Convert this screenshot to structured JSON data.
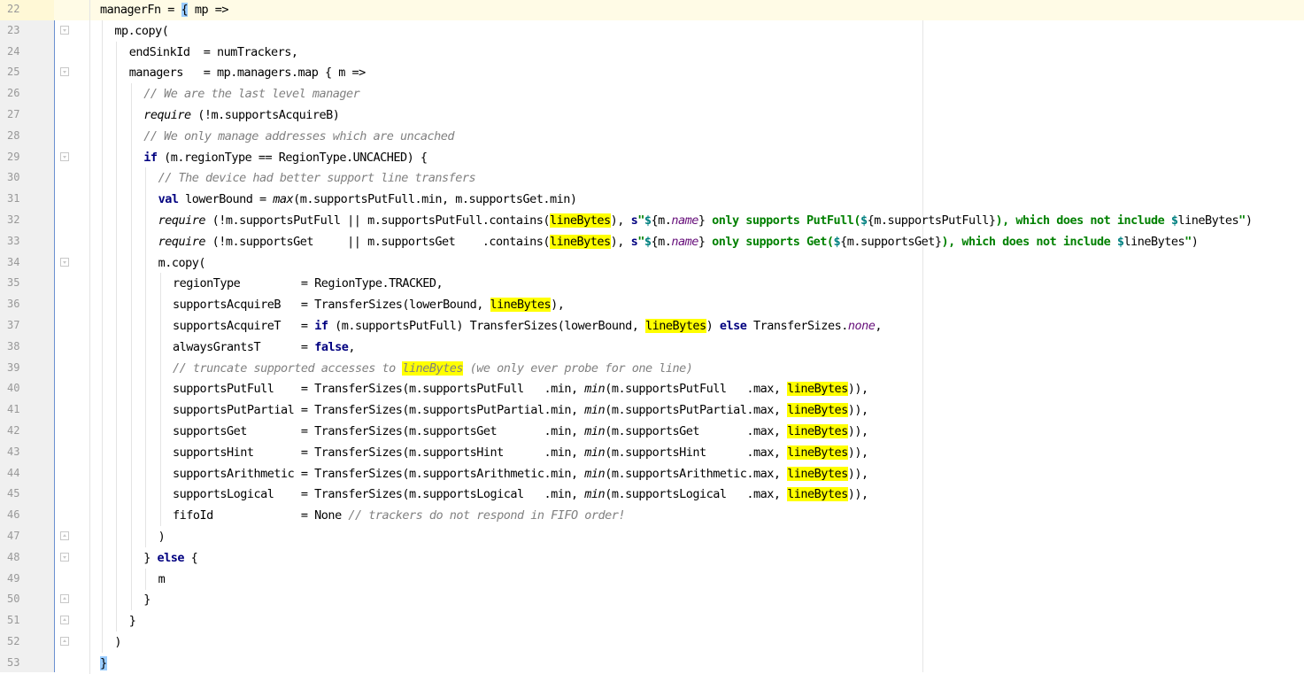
{
  "editor": {
    "lines": [
      {
        "num": "22",
        "indent": 0,
        "current": true,
        "fold": "none",
        "tokens": [
          [
            "plain",
            "managerFn = "
          ],
          [
            "brace",
            "{"
          ],
          [
            "plain",
            " mp =>"
          ]
        ]
      },
      {
        "num": "23",
        "indent": 1,
        "fold": "open",
        "tokens": [
          [
            "plain",
            "mp.copy("
          ]
        ]
      },
      {
        "num": "24",
        "indent": 2,
        "fold": "none",
        "tokens": [
          [
            "plain",
            "endSinkId  = numTrackers,"
          ]
        ]
      },
      {
        "num": "25",
        "indent": 2,
        "fold": "open",
        "tokens": [
          [
            "plain",
            "managers   = mp.managers.map { m =>"
          ]
        ]
      },
      {
        "num": "26",
        "indent": 3,
        "fold": "none",
        "tokens": [
          [
            "cm",
            "// We are the last level manager"
          ]
        ]
      },
      {
        "num": "27",
        "indent": 3,
        "fold": "none",
        "tokens": [
          [
            "ital",
            "require"
          ],
          [
            "plain",
            " (!m.supportsAcquireB)"
          ]
        ]
      },
      {
        "num": "28",
        "indent": 3,
        "fold": "none",
        "tokens": [
          [
            "cm",
            "// We only manage addresses which are uncached"
          ]
        ]
      },
      {
        "num": "29",
        "indent": 3,
        "fold": "open",
        "tokens": [
          [
            "kw",
            "if"
          ],
          [
            "plain",
            " (m.regionType == RegionType.UNCACHED) {"
          ]
        ]
      },
      {
        "num": "30",
        "indent": 4,
        "fold": "none",
        "tokens": [
          [
            "cm",
            "// The device had better support line transfers"
          ]
        ]
      },
      {
        "num": "31",
        "indent": 4,
        "fold": "none",
        "tokens": [
          [
            "kw",
            "val"
          ],
          [
            "plain",
            " lowerBound = "
          ],
          [
            "ital",
            "max"
          ],
          [
            "plain",
            "(m.supportsPutFull.min, m.supportsGet.min)"
          ]
        ]
      },
      {
        "num": "32",
        "indent": 4,
        "fold": "none",
        "tokens": [
          [
            "ital",
            "require"
          ],
          [
            "plain",
            " (!m.supportsPutFull || m.supportsPutFull.contains("
          ],
          [
            "hl",
            "lineBytes"
          ],
          [
            "plain",
            "), "
          ],
          [
            "kw",
            "s"
          ],
          [
            "str",
            "\""
          ],
          [
            "interp",
            "$"
          ],
          [
            "plain",
            "{m."
          ],
          [
            "fld",
            "name"
          ],
          [
            "plain",
            "}"
          ],
          [
            "str",
            " only supports PutFull("
          ],
          [
            "interp",
            "$"
          ],
          [
            "plain",
            "{m.supportsPutFull}"
          ],
          [
            "str",
            "), which does not include "
          ],
          [
            "interp",
            "$"
          ],
          [
            "plain",
            "lineBytes"
          ],
          [
            "str",
            "\""
          ],
          [
            "plain",
            ")"
          ]
        ]
      },
      {
        "num": "33",
        "indent": 4,
        "fold": "none",
        "tokens": [
          [
            "ital",
            "require"
          ],
          [
            "plain",
            " (!m.supportsGet     || m.supportsGet    .contains("
          ],
          [
            "hl",
            "lineBytes"
          ],
          [
            "plain",
            "), "
          ],
          [
            "kw",
            "s"
          ],
          [
            "str",
            "\""
          ],
          [
            "interp",
            "$"
          ],
          [
            "plain",
            "{m."
          ],
          [
            "fld",
            "name"
          ],
          [
            "plain",
            "}"
          ],
          [
            "str",
            " only supports Get("
          ],
          [
            "interp",
            "$"
          ],
          [
            "plain",
            "{m.supportsGet}"
          ],
          [
            "str",
            "), which does not include "
          ],
          [
            "interp",
            "$"
          ],
          [
            "plain",
            "lineBytes"
          ],
          [
            "str",
            "\""
          ],
          [
            "plain",
            ")"
          ]
        ]
      },
      {
        "num": "34",
        "indent": 4,
        "fold": "open",
        "tokens": [
          [
            "plain",
            "m.copy("
          ]
        ]
      },
      {
        "num": "35",
        "indent": 5,
        "fold": "none",
        "tokens": [
          [
            "plain",
            "regionType         = RegionType.TRACKED,"
          ]
        ]
      },
      {
        "num": "36",
        "indent": 5,
        "fold": "none",
        "tokens": [
          [
            "plain",
            "supportsAcquireB   = TransferSizes(lowerBound, "
          ],
          [
            "hl",
            "lineBytes"
          ],
          [
            "plain",
            "),"
          ]
        ]
      },
      {
        "num": "37",
        "indent": 5,
        "fold": "none",
        "tokens": [
          [
            "plain",
            "supportsAcquireT   = "
          ],
          [
            "kw",
            "if"
          ],
          [
            "plain",
            " (m.supportsPutFull) TransferSizes(lowerBound, "
          ],
          [
            "hl",
            "lineBytes"
          ],
          [
            "plain",
            ") "
          ],
          [
            "kw",
            "else"
          ],
          [
            "plain",
            " TransferSizes."
          ],
          [
            "fld",
            "none"
          ],
          [
            "plain",
            ","
          ]
        ]
      },
      {
        "num": "38",
        "indent": 5,
        "fold": "none",
        "tokens": [
          [
            "plain",
            "alwaysGrantsT      = "
          ],
          [
            "kw",
            "false"
          ],
          [
            "plain",
            ","
          ]
        ]
      },
      {
        "num": "39",
        "indent": 5,
        "fold": "none",
        "tokens": [
          [
            "cm",
            "// truncate supported accesses to "
          ],
          [
            "hlcm",
            "lineBytes"
          ],
          [
            "cm",
            " (we only ever probe for one line)"
          ]
        ]
      },
      {
        "num": "40",
        "indent": 5,
        "fold": "none",
        "tokens": [
          [
            "plain",
            "supportsPutFull    = TransferSizes(m.supportsPutFull   .min, "
          ],
          [
            "ital",
            "min"
          ],
          [
            "plain",
            "(m.supportsPutFull   .max, "
          ],
          [
            "hl",
            "lineBytes"
          ],
          [
            "plain",
            ")),"
          ]
        ]
      },
      {
        "num": "41",
        "indent": 5,
        "fold": "none",
        "tokens": [
          [
            "plain",
            "supportsPutPartial = TransferSizes(m.supportsPutPartial.min, "
          ],
          [
            "ital",
            "min"
          ],
          [
            "plain",
            "(m.supportsPutPartial.max, "
          ],
          [
            "hl",
            "lineBytes"
          ],
          [
            "plain",
            ")),"
          ]
        ]
      },
      {
        "num": "42",
        "indent": 5,
        "fold": "none",
        "tokens": [
          [
            "plain",
            "supportsGet        = TransferSizes(m.supportsGet       .min, "
          ],
          [
            "ital",
            "min"
          ],
          [
            "plain",
            "(m.supportsGet       .max, "
          ],
          [
            "hl",
            "lineBytes"
          ],
          [
            "plain",
            ")),"
          ]
        ]
      },
      {
        "num": "43",
        "indent": 5,
        "fold": "none",
        "tokens": [
          [
            "plain",
            "supportsHint       = TransferSizes(m.supportsHint      .min, "
          ],
          [
            "ital",
            "min"
          ],
          [
            "plain",
            "(m.supportsHint      .max, "
          ],
          [
            "hl",
            "lineBytes"
          ],
          [
            "plain",
            ")),"
          ]
        ]
      },
      {
        "num": "44",
        "indent": 5,
        "fold": "none",
        "tokens": [
          [
            "plain",
            "supportsArithmetic = TransferSizes(m.supportsArithmetic.min, "
          ],
          [
            "ital",
            "min"
          ],
          [
            "plain",
            "(m.supportsArithmetic.max, "
          ],
          [
            "hl",
            "lineBytes"
          ],
          [
            "plain",
            ")),"
          ]
        ]
      },
      {
        "num": "45",
        "indent": 5,
        "fold": "none",
        "tokens": [
          [
            "plain",
            "supportsLogical    = TransferSizes(m.supportsLogical   .min, "
          ],
          [
            "ital",
            "min"
          ],
          [
            "plain",
            "(m.supportsLogical   .max, "
          ],
          [
            "hl",
            "lineBytes"
          ],
          [
            "plain",
            ")),"
          ]
        ]
      },
      {
        "num": "46",
        "indent": 5,
        "fold": "none",
        "tokens": [
          [
            "plain",
            "fifoId             = None "
          ],
          [
            "cm",
            "// trackers do not respond in FIFO order!"
          ]
        ]
      },
      {
        "num": "47",
        "indent": 4,
        "fold": "close",
        "tokens": [
          [
            "plain",
            ")"
          ]
        ]
      },
      {
        "num": "48",
        "indent": 3,
        "fold": "open",
        "tokens": [
          [
            "plain",
            "} "
          ],
          [
            "kw",
            "else"
          ],
          [
            "plain",
            " {"
          ]
        ]
      },
      {
        "num": "49",
        "indent": 4,
        "fold": "none",
        "tokens": [
          [
            "plain",
            "m"
          ]
        ]
      },
      {
        "num": "50",
        "indent": 3,
        "fold": "close",
        "tokens": [
          [
            "plain",
            "}"
          ]
        ]
      },
      {
        "num": "51",
        "indent": 2,
        "fold": "close",
        "tokens": [
          [
            "plain",
            "}"
          ]
        ]
      },
      {
        "num": "52",
        "indent": 1,
        "fold": "close",
        "tokens": [
          [
            "plain",
            ")"
          ]
        ]
      },
      {
        "num": "53",
        "indent": 0,
        "fold": "none",
        "tokens": [
          [
            "brace",
            "}"
          ]
        ]
      }
    ]
  }
}
